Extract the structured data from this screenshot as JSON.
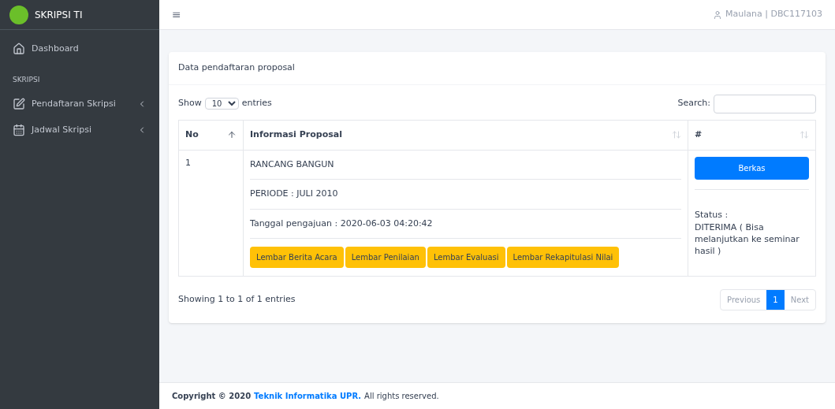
{
  "sidebar": {
    "brand": "SKRIPSI TI",
    "items": [
      {
        "kind": "link",
        "label": "Dashboard",
        "selected": false
      },
      {
        "kind": "header",
        "label": "SKRIPSI"
      },
      {
        "kind": "menu",
        "label": "Pendaftaran Skripsi",
        "expanded": false
      },
      {
        "kind": "menu",
        "label": "Jadwal Skripsi",
        "expanded": false
      }
    ]
  },
  "topbar": {
    "menu_glyph": "≡",
    "user": "Maulana | DBC117103"
  },
  "card": {
    "title": "Data pendaftaran proposal",
    "length": {
      "before": "Show",
      "value": "10",
      "after": "entries"
    },
    "search": {
      "label": "Search:"
    },
    "table": {
      "columns": [
        {
          "label": "No",
          "sorted": true
        },
        {
          "label": "Informasi Proposal",
          "sorted": false
        },
        {
          "label": "#",
          "sorted": false
        }
      ],
      "rows": [
        {
          "no": "1",
          "info": [
            "RANCANG BANGUN",
            "PERIODE : JULI 2010",
            "Tanggal pengajuan : 2020-06-03 04:20:42"
          ],
          "buttons": [
            "Lembar Berita Acara",
            "Lembar Penilaian",
            "Lembar Evaluasi",
            "Lembar Rekapitulasi Nilai"
          ],
          "action": "Berkas",
          "status_label": "Status :",
          "status": "DITERIMA ( Bisa melanjutkan ke seminar hasil )"
        }
      ]
    },
    "info": "Showing 1 to 1 of 1 entries",
    "pagination": [
      {
        "label": "Previous",
        "selected": false
      },
      {
        "label": "1",
        "selected": true
      },
      {
        "label": "Next",
        "selected": false
      }
    ]
  },
  "footer": {
    "prefix": "Copyright © 2020",
    "link": "Teknik Informatika UPR.",
    "suffix": "All rights reserved."
  }
}
